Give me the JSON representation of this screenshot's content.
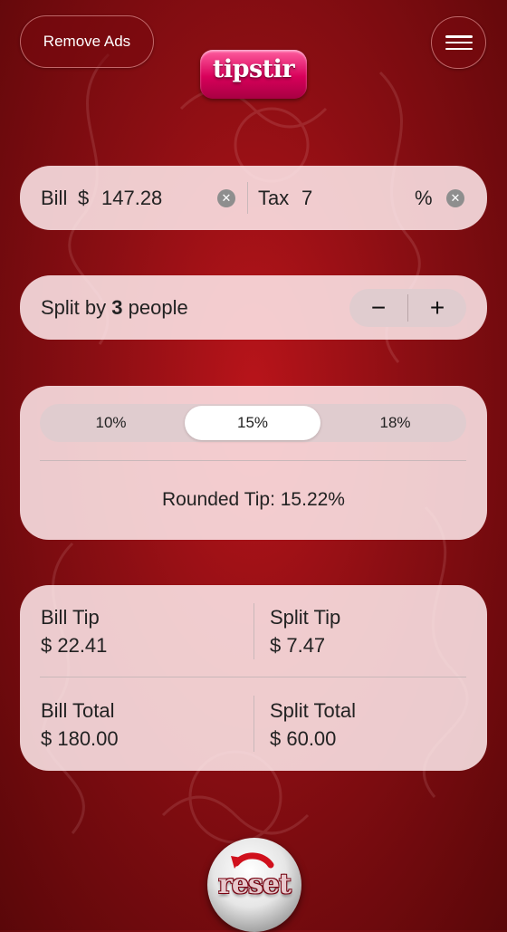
{
  "header": {
    "remove_ads_label": "Remove Ads",
    "menu_icon": "hamburger-icon",
    "logo_text": "tipstir"
  },
  "bill": {
    "bill_label": "Bill",
    "currency": "$",
    "bill_value": "147.28",
    "tax_label": "Tax",
    "tax_value": "7",
    "tax_unit": "%",
    "clear_icon": "clear-x-icon"
  },
  "split": {
    "prefix": "Split by",
    "count": "3",
    "suffix": "people",
    "decrement_label": "−",
    "increment_label": "+"
  },
  "tip": {
    "options": [
      "10%",
      "15%",
      "18%"
    ],
    "selected": "15%",
    "rounded_tip": "Rounded Tip: 15.22%"
  },
  "totals": {
    "bill_tip_label": "Bill Tip",
    "bill_tip_value": "$ 22.41",
    "split_tip_label": "Split Tip",
    "split_tip_value": "$ 7.47",
    "bill_total_label": "Bill Total",
    "bill_total_value": "$ 180.00",
    "split_total_label": "Split Total",
    "split_total_value": "$ 60.00"
  },
  "footer": {
    "reset_label": "reset"
  },
  "colors": {
    "background": "#9e1016",
    "card": "#ffebee",
    "accent_red": "#cc1020"
  }
}
